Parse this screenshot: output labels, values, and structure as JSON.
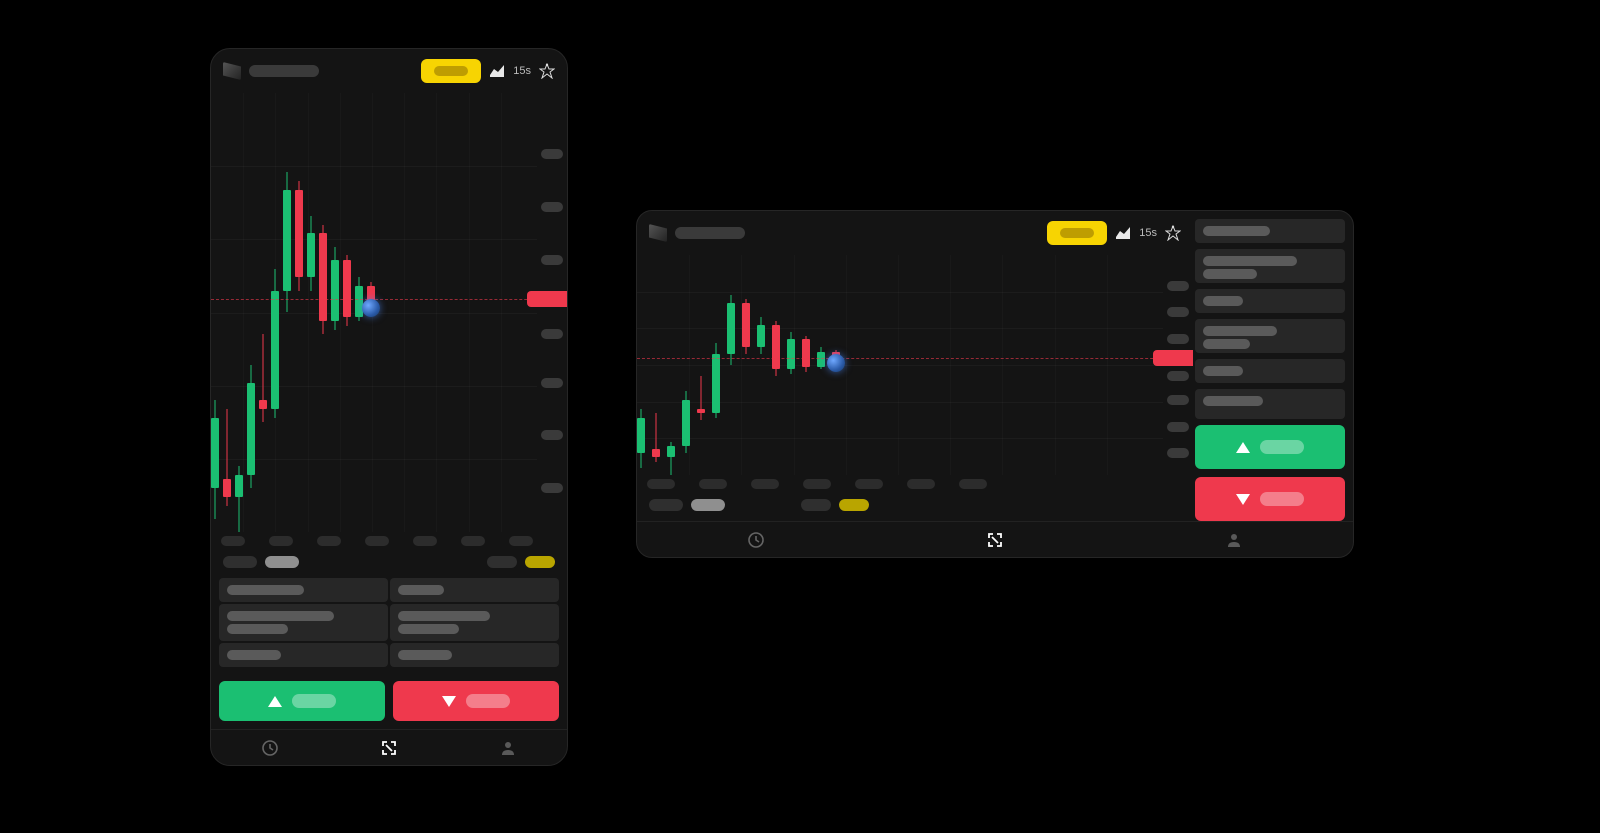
{
  "domain": "Computer-Use",
  "colors": {
    "up": "#1bbf72",
    "down": "#ef394d",
    "accent": "#f7d402",
    "cursor": "#4a88d8",
    "bg": "#141414"
  },
  "topbar": {
    "timeframe": "15s",
    "yellow_btn": "",
    "chart_type_icon": "area-chart-icon",
    "tools_icon": "drawing-tool-icon"
  },
  "actions": {
    "buy_label": "",
    "sell_label": ""
  },
  "nav": {
    "items": [
      "history",
      "fullscreen",
      "profile"
    ],
    "active_index": 1
  },
  "side_rows": {
    "count": 6
  },
  "chart_data": {
    "type": "candlestick",
    "timeframe": "15s",
    "y_range": [
      0,
      100
    ],
    "price_line": 53,
    "y_ticks": [
      10,
      22,
      34,
      45,
      53,
      62,
      74,
      86
    ],
    "candles": [
      {
        "i": 0,
        "o": 10,
        "h": 30,
        "l": 3,
        "c": 26,
        "dir": "up"
      },
      {
        "i": 1,
        "o": 12,
        "h": 28,
        "l": 6,
        "c": 8,
        "dir": "dn"
      },
      {
        "i": 2,
        "o": 8,
        "h": 15,
        "l": 0,
        "c": 13,
        "dir": "up"
      },
      {
        "i": 3,
        "o": 13,
        "h": 38,
        "l": 10,
        "c": 34,
        "dir": "up"
      },
      {
        "i": 4,
        "o": 30,
        "h": 45,
        "l": 25,
        "c": 28,
        "dir": "dn"
      },
      {
        "i": 5,
        "o": 28,
        "h": 60,
        "l": 26,
        "c": 55,
        "dir": "up"
      },
      {
        "i": 6,
        "o": 55,
        "h": 82,
        "l": 50,
        "c": 78,
        "dir": "up"
      },
      {
        "i": 7,
        "o": 78,
        "h": 80,
        "l": 55,
        "c": 58,
        "dir": "dn"
      },
      {
        "i": 8,
        "o": 58,
        "h": 72,
        "l": 55,
        "c": 68,
        "dir": "up"
      },
      {
        "i": 9,
        "o": 68,
        "h": 70,
        "l": 45,
        "c": 48,
        "dir": "dn"
      },
      {
        "i": 10,
        "o": 48,
        "h": 65,
        "l": 46,
        "c": 62,
        "dir": "up"
      },
      {
        "i": 11,
        "o": 62,
        "h": 63,
        "l": 47,
        "c": 49,
        "dir": "dn"
      },
      {
        "i": 12,
        "o": 49,
        "h": 58,
        "l": 48,
        "c": 56,
        "dir": "up"
      },
      {
        "i": 13,
        "o": 56,
        "h": 57,
        "l": 50,
        "c": 51,
        "dir": "dn"
      }
    ],
    "x_ticks": 7
  }
}
